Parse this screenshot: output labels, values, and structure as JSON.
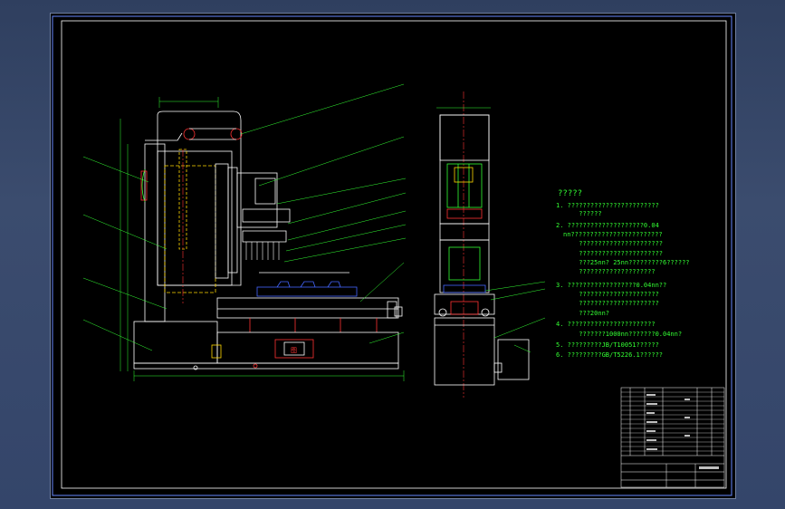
{
  "drawing": {
    "notes": {
      "title": "?????",
      "lines": [
        "1. ????????????????????????",
        "      ??????",
        "2. ????????????????????0.04",
        "nn????????????????????????",
        "      ??????????????????????",
        "      ??????????????????????",
        "      ???25nn? 25nn?????????6??????",
        "      ????????????????????",
        "3. ??????????????????0.04nn??",
        "      ?????????????????????",
        "      ?????????????????????",
        "      ???20nn?",
        "4. ???????????????????????",
        "      ???????1000nn???????0.04nn?",
        "5. ?????????JB/T10051??????",
        "6. ?????????GB/T5226.1??????"
      ]
    },
    "panel_label": "图"
  },
  "colors": {
    "frame": "#ffffff",
    "outline": "#ffffff",
    "leader": "#33ff33",
    "hidden": "#ffd700",
    "centerline": "#ff3333",
    "blue": "#4466ff",
    "notes": "#33ff33"
  }
}
